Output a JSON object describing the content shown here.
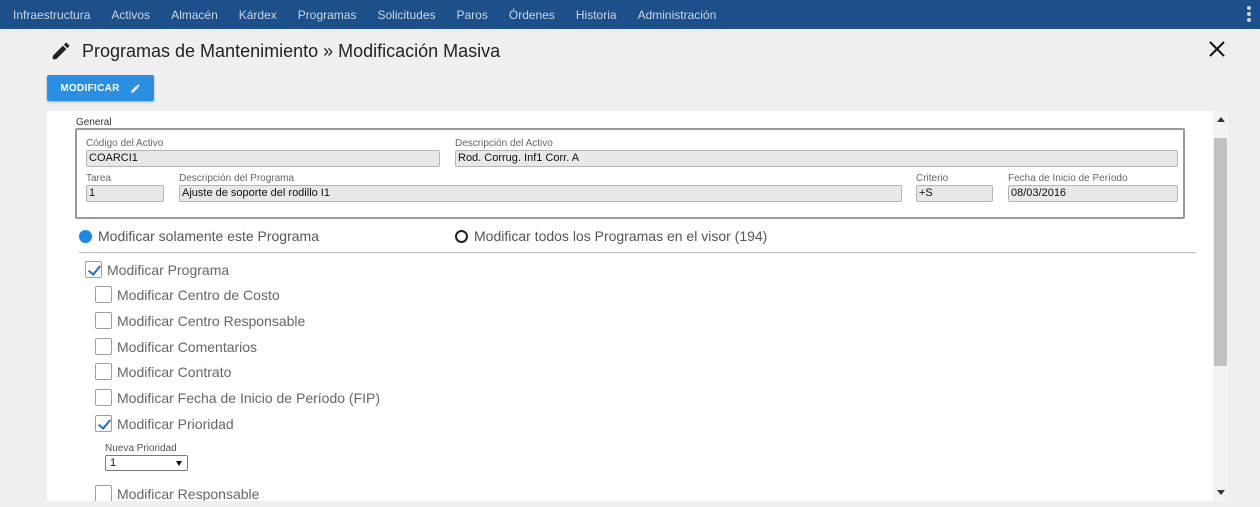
{
  "nav": {
    "items": [
      "Infraestructura",
      "Activos",
      "Almacén",
      "Kárdex",
      "Programas",
      "Solicitudes",
      "Paros",
      "Órdenes",
      "Historia",
      "Administración"
    ]
  },
  "header": {
    "title": "Programas de Mantenimiento » Modificación Masiva",
    "modify_label": "MODIFICAR"
  },
  "general": {
    "legend": "General",
    "fields": {
      "codigo": {
        "label": "Código del Activo",
        "value": "COARCI1"
      },
      "descripcion_activo": {
        "label": "Descripción del Activo",
        "value": "Rod. Corrug. Inf1 Corr. A"
      },
      "tarea": {
        "label": "Tarea",
        "value": "1"
      },
      "descripcion_programa": {
        "label": "Descripción del Programa",
        "value": "Ajuste de soporte del rodillo I1"
      },
      "criterio": {
        "label": "Criterio",
        "value": "+S"
      },
      "fecha_inicio": {
        "label": "Fecha de Inicio de Período",
        "value": "08/03/2016"
      }
    }
  },
  "scope": {
    "options": [
      {
        "label": "Modificar solamente este Programa",
        "selected": true
      },
      {
        "label": "Modificar todos los Programas en el visor (194)",
        "selected": false
      }
    ]
  },
  "options": {
    "main": {
      "label": "Modificar Programa",
      "checked": true
    },
    "items": [
      {
        "label": "Modificar Centro de Costo",
        "checked": false
      },
      {
        "label": "Modificar Centro Responsable",
        "checked": false
      },
      {
        "label": "Modificar Comentarios",
        "checked": false
      },
      {
        "label": "Modificar Contrato",
        "checked": false
      },
      {
        "label": "Modificar Fecha de Inicio de Período (FIP)",
        "checked": false
      },
      {
        "label": "Modificar Prioridad",
        "checked": true
      },
      {
        "label": "Modificar Responsable",
        "checked": false
      }
    ],
    "prioridad": {
      "label": "Nueva Prioridad",
      "value": "1"
    }
  },
  "colors": {
    "nav_bg": "#1d4f8a",
    "accent": "#2a8fe0",
    "radio_selected": "#1e88e5"
  }
}
